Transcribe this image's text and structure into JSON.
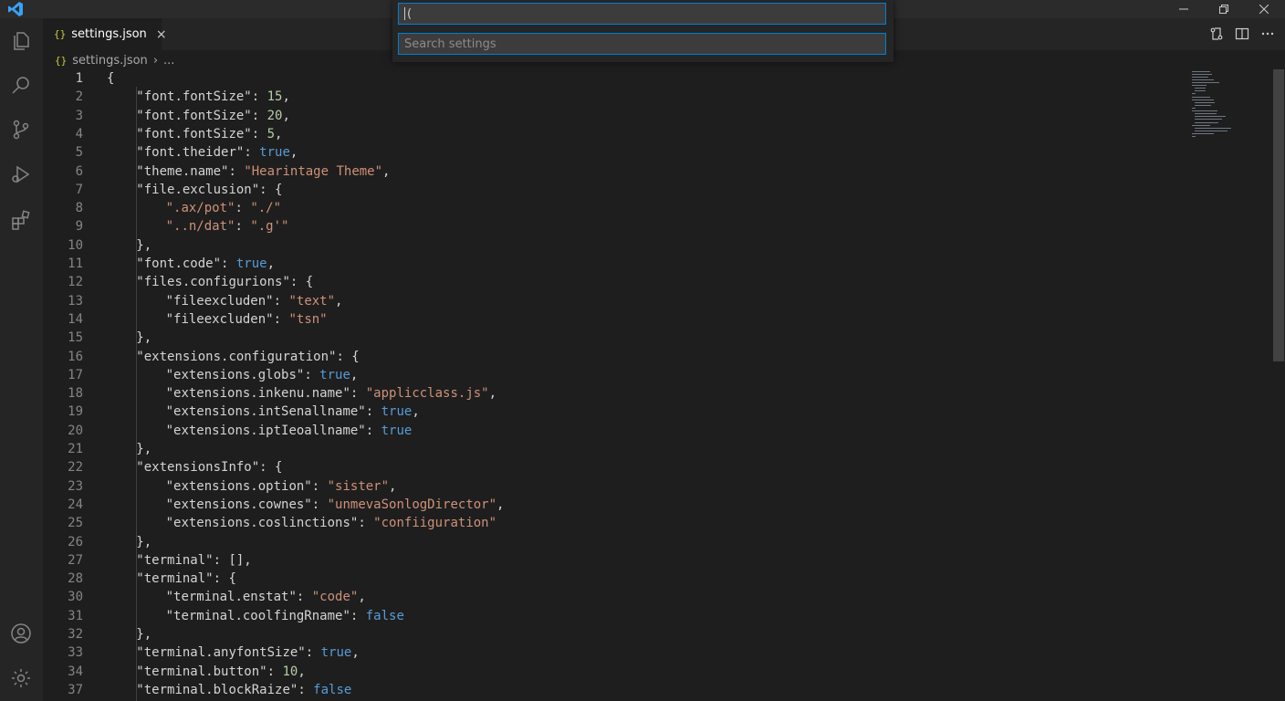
{
  "titlebar": {
    "controls": [
      "minimize-icon",
      "restore-icon",
      "close-icon"
    ]
  },
  "activity_bar": {
    "items": [
      "explorer-icon",
      "search-icon",
      "source-control-icon",
      "run-debug-icon",
      "extensions-icon"
    ],
    "bottom_items": [
      "account-icon",
      "settings-gear-icon"
    ]
  },
  "tabs": [
    {
      "label": "settings.json",
      "icon": "json-icon",
      "active": true
    }
  ],
  "tab_icon_glyph": "{}",
  "tab_close_glyph": "×",
  "editor_actions": [
    "open-changes-icon",
    "split-editor-icon",
    "more-actions-icon"
  ],
  "breadcrumb": {
    "file": "settings.json",
    "separator": "›",
    "rest": "..."
  },
  "quick_input": {
    "command_value": "(",
    "search_placeholder": "Search settings"
  },
  "colors": {
    "editor_bg": "#1e1e1e",
    "accent": "#007fd4",
    "string": "#ce9178",
    "number": "#b5cea8",
    "boolean": "#569cd6"
  },
  "editor": {
    "lines": [
      {
        "n": "1",
        "indent": 0,
        "tokens": [
          [
            "p",
            "{"
          ]
        ]
      },
      {
        "n": "2",
        "indent": 1,
        "tokens": [
          [
            "key",
            "\"font.fontSize\""
          ],
          [
            "p",
            ": "
          ],
          [
            "n",
            "15"
          ],
          [
            "p",
            ","
          ]
        ]
      },
      {
        "n": "3",
        "indent": 1,
        "tokens": [
          [
            "key",
            "\"font.fontSize\""
          ],
          [
            "p",
            ": "
          ],
          [
            "n",
            "20"
          ],
          [
            "p",
            ","
          ]
        ]
      },
      {
        "n": "4",
        "indent": 1,
        "tokens": [
          [
            "key",
            "\"font.fontSize\""
          ],
          [
            "p",
            ": "
          ],
          [
            "n",
            "5"
          ],
          [
            "p",
            ","
          ]
        ]
      },
      {
        "n": "5",
        "indent": 1,
        "tokens": [
          [
            "key",
            "\"font.theider\""
          ],
          [
            "p",
            ": "
          ],
          [
            "b",
            "true"
          ],
          [
            "p",
            ","
          ]
        ]
      },
      {
        "n": "6",
        "indent": 1,
        "tokens": [
          [
            "key",
            "\"theme.name\""
          ],
          [
            "p",
            ": "
          ],
          [
            "s",
            "\"Hearintage Theme\""
          ],
          [
            "p",
            ","
          ]
        ]
      },
      {
        "n": "7",
        "indent": 1,
        "tokens": [
          [
            "key",
            "\"file.exclusion\""
          ],
          [
            "p",
            ": {"
          ]
        ]
      },
      {
        "n": "8",
        "indent": 2,
        "tokens": [
          [
            "s",
            "\".ax/pot\""
          ],
          [
            "p",
            ": "
          ],
          [
            "s",
            "\"./\""
          ]
        ]
      },
      {
        "n": "9",
        "indent": 2,
        "tokens": [
          [
            "s",
            "\"..n/dat\""
          ],
          [
            "p",
            ": "
          ],
          [
            "s",
            "\".g'\""
          ]
        ]
      },
      {
        "n": "10",
        "indent": 1,
        "tokens": [
          [
            "p",
            "},"
          ]
        ]
      },
      {
        "n": "11",
        "indent": 1,
        "tokens": [
          [
            "key",
            "\"font.code\""
          ],
          [
            "p",
            ": "
          ],
          [
            "b",
            "true"
          ],
          [
            "p",
            ","
          ]
        ]
      },
      {
        "n": "12",
        "indent": 1,
        "tokens": [
          [
            "key",
            "\"files.configurions\""
          ],
          [
            "p",
            ": {"
          ]
        ]
      },
      {
        "n": "13",
        "indent": 2,
        "tokens": [
          [
            "key",
            "\"fileexcluden\""
          ],
          [
            "p",
            ": "
          ],
          [
            "s",
            "\"text\""
          ],
          [
            "p",
            ","
          ]
        ]
      },
      {
        "n": "14",
        "indent": 2,
        "tokens": [
          [
            "key",
            "\"fileexcluden\""
          ],
          [
            "p",
            ": "
          ],
          [
            "s",
            "\"tsn\""
          ]
        ]
      },
      {
        "n": "15",
        "indent": 1,
        "tokens": [
          [
            "p",
            "},"
          ]
        ]
      },
      {
        "n": "16",
        "indent": 1,
        "tokens": [
          [
            "key",
            "\"extensions.configuration\""
          ],
          [
            "p",
            ": {"
          ]
        ]
      },
      {
        "n": "17",
        "indent": 2,
        "tokens": [
          [
            "key",
            "\"extensions.globs\""
          ],
          [
            "p",
            ": "
          ],
          [
            "b",
            "true"
          ],
          [
            "p",
            ","
          ]
        ]
      },
      {
        "n": "18",
        "indent": 2,
        "tokens": [
          [
            "key",
            "\"extensions.inkenu.name\""
          ],
          [
            "p",
            ": "
          ],
          [
            "s",
            "\"applicclass.js\""
          ],
          [
            "p",
            ","
          ]
        ]
      },
      {
        "n": "19",
        "indent": 2,
        "tokens": [
          [
            "key",
            "\"extensions.intSenallname\""
          ],
          [
            "p",
            ": "
          ],
          [
            "b",
            "true"
          ],
          [
            "p",
            ","
          ]
        ]
      },
      {
        "n": "20",
        "indent": 2,
        "tokens": [
          [
            "key",
            "\"extensions.iptIeoallname\""
          ],
          [
            "p",
            ": "
          ],
          [
            "b",
            "true"
          ]
        ]
      },
      {
        "n": "21",
        "indent": 1,
        "tokens": [
          [
            "p",
            "},"
          ]
        ]
      },
      {
        "n": "22",
        "indent": 1,
        "tokens": [
          [
            "key",
            "\"extensionsInfo\""
          ],
          [
            "p",
            ": {"
          ]
        ]
      },
      {
        "n": "23",
        "indent": 2,
        "tokens": [
          [
            "key",
            "\"extensions.option\""
          ],
          [
            "p",
            ": "
          ],
          [
            "s",
            "\"sister\""
          ],
          [
            "p",
            ","
          ]
        ]
      },
      {
        "n": "24",
        "indent": 2,
        "tokens": [
          [
            "key",
            "\"extensions.cownes\""
          ],
          [
            "p",
            ": "
          ],
          [
            "s",
            "\"unmevaSonlogDirector\""
          ],
          [
            "p",
            ","
          ]
        ]
      },
      {
        "n": "25",
        "indent": 2,
        "tokens": [
          [
            "key",
            "\"extensions.coslinctions\""
          ],
          [
            "p",
            ": "
          ],
          [
            "s",
            "\"confiiguration\""
          ]
        ]
      },
      {
        "n": "26",
        "indent": 1,
        "tokens": [
          [
            "p",
            "},"
          ]
        ]
      },
      {
        "n": "27",
        "indent": 1,
        "tokens": [
          [
            "key",
            "\"terminal\""
          ],
          [
            "p",
            ": [],"
          ]
        ]
      },
      {
        "n": "28",
        "indent": 1,
        "tokens": [
          [
            "key",
            "\"terminal\""
          ],
          [
            "p",
            ": {"
          ]
        ]
      },
      {
        "n": "30",
        "indent": 2,
        "tokens": [
          [
            "key",
            "\"terminal.enstat\""
          ],
          [
            "p",
            ": "
          ],
          [
            "s",
            "\"code\""
          ],
          [
            "p",
            ","
          ]
        ]
      },
      {
        "n": "31",
        "indent": 2,
        "tokens": [
          [
            "key",
            "\"terminal.coolfingRname\""
          ],
          [
            "p",
            ": "
          ],
          [
            "b",
            "false"
          ]
        ]
      },
      {
        "n": "32",
        "indent": 1,
        "tokens": [
          [
            "p",
            "},"
          ]
        ]
      },
      {
        "n": "33",
        "indent": 1,
        "tokens": [
          [
            "key",
            "\"terminal.anyfontSize\""
          ],
          [
            "p",
            ": "
          ],
          [
            "b",
            "true"
          ],
          [
            "p",
            ","
          ]
        ]
      },
      {
        "n": "34",
        "indent": 1,
        "tokens": [
          [
            "key",
            "\"terminal.button\""
          ],
          [
            "p",
            ": "
          ],
          [
            "n",
            "10"
          ],
          [
            "p",
            ","
          ]
        ]
      },
      {
        "n": "37",
        "indent": 1,
        "tokens": [
          [
            "key",
            "\"terminal.blockRaize\""
          ],
          [
            "p",
            ": "
          ],
          [
            "b",
            "false"
          ]
        ]
      }
    ]
  }
}
